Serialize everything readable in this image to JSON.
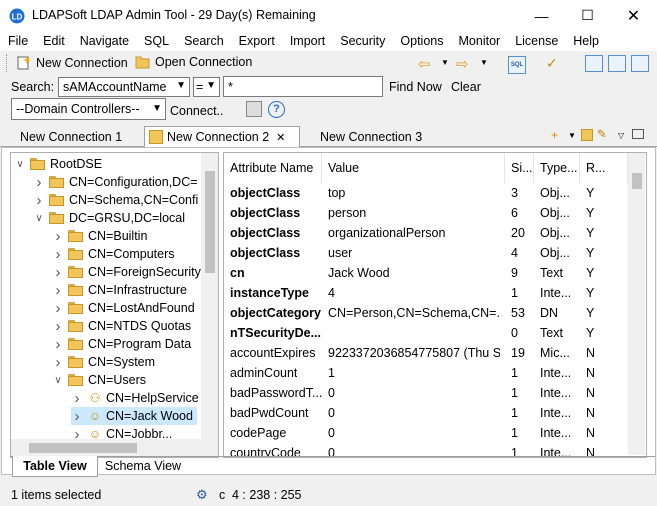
{
  "window": {
    "title": "LDAPSoft LDAP Admin Tool - 29 Day(s) Remaining"
  },
  "menu": [
    "File",
    "Edit",
    "Navigate",
    "SQL",
    "Search",
    "Export",
    "Import",
    "Security",
    "Options",
    "Monitor",
    "License",
    "Help"
  ],
  "toolbar": {
    "new_connection": "New Connection",
    "open_connection": "Open Connection",
    "search_label": "Search:",
    "search_attribute": "sAMAccountName",
    "operator": "=",
    "search_value": "*",
    "find_now": "Find Now",
    "clear": "Clear",
    "scope": "--Domain Controllers--",
    "connect": "Connect.."
  },
  "tabs": [
    "New Connection 1",
    "New Connection 2",
    "New Connection 3"
  ],
  "tree": [
    {
      "label": "RootDSE",
      "level": 0,
      "exp": "open"
    },
    {
      "label": "CN=Configuration,DC=",
      "level": 1,
      "exp": "closed"
    },
    {
      "label": "CN=Schema,CN=Confi",
      "level": 1,
      "exp": "closed"
    },
    {
      "label": "DC=GRSU,DC=local",
      "level": 1,
      "exp": "open"
    },
    {
      "label": "CN=Builtin",
      "level": 2,
      "exp": "closed"
    },
    {
      "label": "CN=Computers",
      "level": 2,
      "exp": "closed"
    },
    {
      "label": "CN=ForeignSecurity",
      "level": 2,
      "exp": "closed"
    },
    {
      "label": "CN=Infrastructure",
      "level": 2,
      "exp": "closed"
    },
    {
      "label": "CN=LostAndFound",
      "level": 2,
      "exp": "closed"
    },
    {
      "label": "CN=NTDS Quotas",
      "level": 2,
      "exp": "closed"
    },
    {
      "label": "CN=Program Data",
      "level": 2,
      "exp": "closed"
    },
    {
      "label": "CN=System",
      "level": 2,
      "exp": "closed"
    },
    {
      "label": "CN=Users",
      "level": 2,
      "exp": "open"
    },
    {
      "label": "CN=HelpService",
      "level": 3,
      "exp": "closed",
      "icon": "group"
    },
    {
      "label": "CN=Jack Wood",
      "level": 3,
      "exp": "closed",
      "icon": "user",
      "selected": true
    },
    {
      "label": "CN=Jobbr...",
      "level": 3,
      "exp": "closed",
      "icon": "user"
    }
  ],
  "grid": {
    "headers": [
      "Attribute Name",
      "Value",
      "Si...",
      "Type...",
      "R..."
    ],
    "rows": [
      {
        "name": "objectClass",
        "value": "top",
        "size": "3",
        "type": "Obj...",
        "r": "Y",
        "bold": true
      },
      {
        "name": "objectClass",
        "value": "person",
        "size": "6",
        "type": "Obj...",
        "r": "Y",
        "bold": true
      },
      {
        "name": "objectClass",
        "value": "organizationalPerson",
        "size": "20",
        "type": "Obj...",
        "r": "Y",
        "bold": true
      },
      {
        "name": "objectClass",
        "value": "user",
        "size": "4",
        "type": "Obj...",
        "r": "Y",
        "bold": true
      },
      {
        "name": "cn",
        "value": "Jack Wood",
        "size": "9",
        "type": "Text",
        "r": "Y",
        "bold": true
      },
      {
        "name": "instanceType",
        "value": "4",
        "size": "1",
        "type": "Inte...",
        "r": "Y",
        "bold": true
      },
      {
        "name": "objectCategory",
        "value": "CN=Person,CN=Schema,CN=...",
        "size": "53",
        "type": "DN",
        "r": "Y",
        "bold": true
      },
      {
        "name": "nTSecurityDe...",
        "value": "",
        "size": "0",
        "type": "Text",
        "r": "Y",
        "bold": true
      },
      {
        "name": "accountExpires",
        "value": "9223372036854775807 (Thu Se...",
        "size": "19",
        "type": "Mic...",
        "r": "N",
        "bold": false
      },
      {
        "name": "adminCount",
        "value": "1",
        "size": "1",
        "type": "Inte...",
        "r": "N",
        "bold": false
      },
      {
        "name": "badPasswordT...",
        "value": "0",
        "size": "1",
        "type": "Inte...",
        "r": "N",
        "bold": false
      },
      {
        "name": "badPwdCount",
        "value": "0",
        "size": "1",
        "type": "Inte...",
        "r": "N",
        "bold": false
      },
      {
        "name": "codePage",
        "value": "0",
        "size": "1",
        "type": "Inte...",
        "r": "N",
        "bold": false
      },
      {
        "name": "countryCode",
        "value": "0",
        "size": "1",
        "type": "Inte...",
        "r": "N",
        "bold": false
      }
    ]
  },
  "bottom_tabs": [
    "Table View",
    "Schema View"
  ],
  "status": {
    "selected": "1 items selected",
    "mode": "c",
    "position": "4 : 238 : 255"
  },
  "colors": {
    "accent": "#0078d7",
    "selection": "#cce8ff"
  }
}
